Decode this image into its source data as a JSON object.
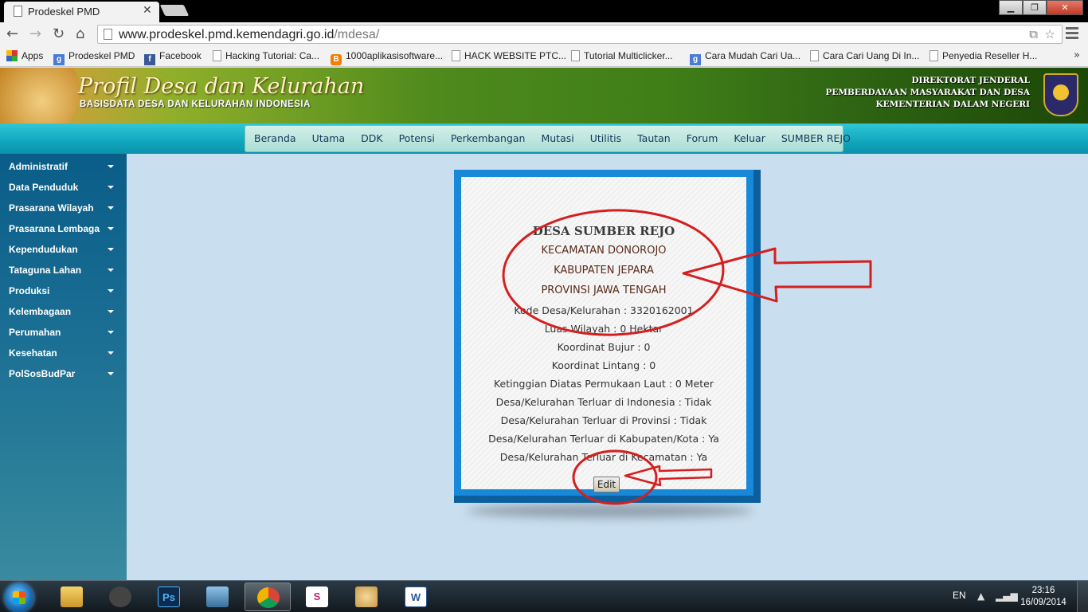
{
  "browser": {
    "tab_title": "Prodeskel PMD",
    "url_host": "www.prodeskel.pmd.kemendagri.go.id",
    "url_path": "/mdesa/"
  },
  "bookmarks": [
    {
      "label": "Apps",
      "icon": "apps"
    },
    {
      "label": "Prodeskel PMD",
      "icon": "google"
    },
    {
      "label": "Facebook",
      "icon": "fb"
    },
    {
      "label": "Hacking Tutorial: Ca...",
      "icon": "page"
    },
    {
      "label": "1000aplikasisoftware...",
      "icon": "blogger"
    },
    {
      "label": "HACK WEBSITE PTC...",
      "icon": "page"
    },
    {
      "label": "Tutorial Multiclicker...",
      "icon": "page"
    },
    {
      "label": "Cara Mudah Cari Ua...",
      "icon": "google"
    },
    {
      "label": "Cara Cari Uang Di In...",
      "icon": "page"
    },
    {
      "label": "Penyedia Reseller H...",
      "icon": "page"
    }
  ],
  "site": {
    "title": "Profil Desa dan Kelurahan",
    "subtitle": "BASISDATA DESA DAN KELURAHAN INDONESIA",
    "ministry": [
      "DIREKTORAT JENDERAL",
      "PEMBERDAYAAN MASYARAKAT DAN DESA",
      "KEMENTERIAN DALAM NEGERI"
    ]
  },
  "main_menu": [
    "Beranda",
    "Utama",
    "DDK",
    "Potensi",
    "Perkembangan",
    "Mutasi",
    "Utilitis",
    "Tautan",
    "Forum",
    "Keluar",
    "SUMBER REJO"
  ],
  "sidebar": [
    "Administratif",
    "Data Penduduk",
    "Prasarana Wilayah",
    "Prasarana Lembaga",
    "Kependudukan",
    "Tataguna Lahan",
    "Produksi",
    "Kelembagaan",
    "Perumahan",
    "Kesehatan",
    "PolSosBudPar"
  ],
  "village": {
    "name": "DESA SUMBER REJO",
    "kecamatan": "KECAMATAN DONOROJO",
    "kabupaten": "KABUPATEN JEPARA",
    "provinsi": "PROVINSI JAWA TENGAH",
    "details": [
      "Kode Desa/Kelurahan : 3320162001",
      "Luas Wilayah : 0 Hektar",
      "Koordinat Bujur : 0",
      "Koordinat Lintang : 0",
      "Ketinggian Diatas Permukaan Laut : 0 Meter",
      "Desa/Kelurahan Terluar di Indonesia : Tidak",
      "Desa/Kelurahan Terluar di Provinsi : Tidak",
      "Desa/Kelurahan Terluar di Kabupaten/Kota : Ya",
      "Desa/Kelurahan Terluar di Kecamatan : Ya"
    ],
    "edit_label": "Edit"
  },
  "taskbar": {
    "language": "EN",
    "time": "23:16",
    "date": "16/09/2014"
  },
  "colors": {
    "annotation": "#d51f1f",
    "nav_strip": "#10a6bd",
    "sidebar": "#1a6d93",
    "card_border": "#1888d8"
  }
}
